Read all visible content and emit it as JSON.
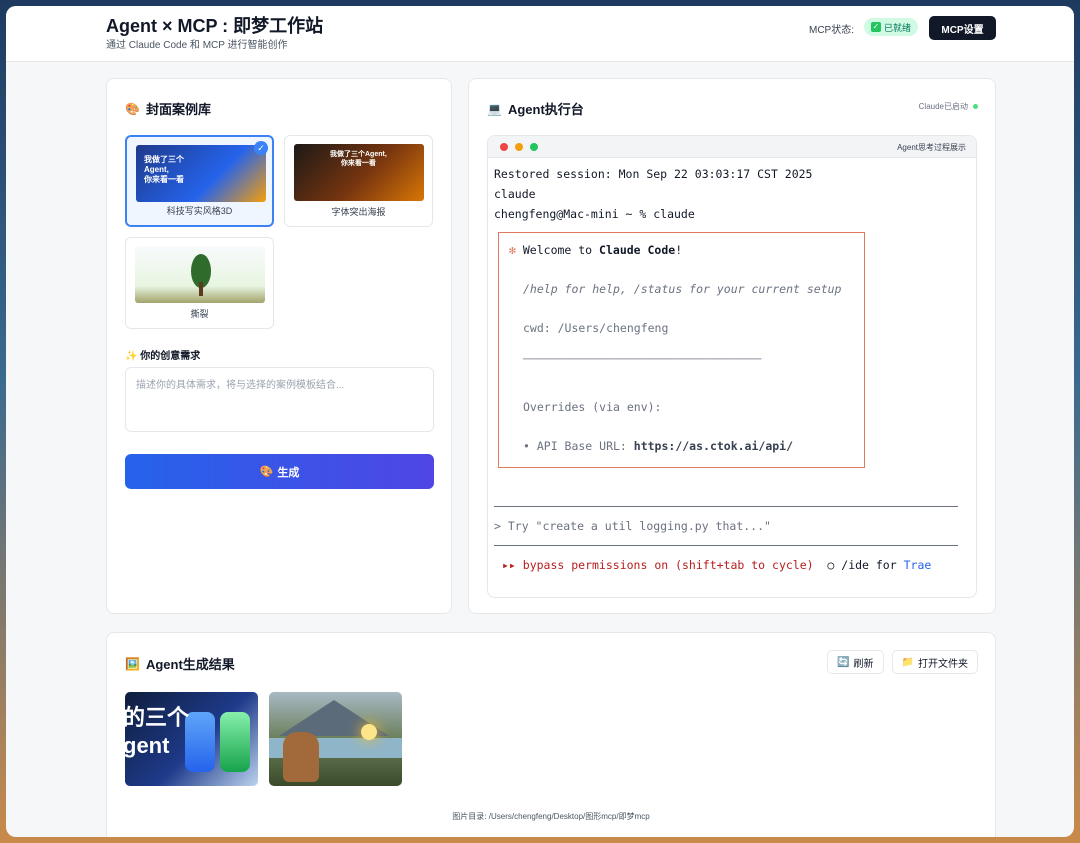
{
  "header": {
    "title": "Agent × MCP : 即梦工作站",
    "subtitle": "通过 Claude Code 和 MCP 进行智能创作",
    "mcp_status_label": "MCP状态:",
    "mcp_status_badge": "已就绪",
    "mcp_settings_button": "MCP设置",
    "status_color": "#22c55e"
  },
  "case_library": {
    "title": "封面案例库",
    "icon": "palette-icon",
    "cases": [
      {
        "label": "科技写实风格3D",
        "selected": true,
        "thumb_text": "我做了三个\nAgent,\n你来看一看"
      },
      {
        "label": "字体突出海报",
        "selected": false,
        "thumb_text": "我做了三个Agent,\n你来看一看"
      },
      {
        "label": "撕裂",
        "selected": false,
        "thumb_text": ""
      }
    ],
    "idea_label": "你的创意需求",
    "idea_placeholder": "描述你的具体需求，将与选择的案例模板结合...",
    "generate_button": "生成"
  },
  "agent_console": {
    "title": "Agent执行台",
    "claude_status": "Claude已启动",
    "terminal_title": "Agent思考过程展示",
    "lines": {
      "restored": "Restored session: Mon Sep 22 03:03:17 CST 2025",
      "claude": "claude",
      "prompt": "chengfeng@Mac-mini ~ % claude",
      "welcome_prefix": "Welcome to ",
      "welcome_bold": "Claude Code",
      "welcome_suffix": "!",
      "help": "/help for help, /status for your current setup",
      "cwd": "cwd: /Users/chengfeng",
      "separator": "────────────────────────────────────────────",
      "overrides": "Overrides (via env):",
      "api_prefix": "• API Base URL: ",
      "api_url": "https://as.ctok.ai/api/",
      "try": "> Try \"create a util logging.py that...\"",
      "bypass": "▸▸ bypass permissions on (shift+tab to cycle)",
      "ide_prefix": "○ /ide for ",
      "ide_target": "Trae"
    }
  },
  "results": {
    "title": "Agent生成结果",
    "refresh_button": "刷新",
    "open_folder_button": "打开文件夹",
    "image1_text": "的三个\ngent",
    "image_dir": "图片目录: /Users/chengfeng/Desktop/图形mcp/即梦mcp"
  }
}
